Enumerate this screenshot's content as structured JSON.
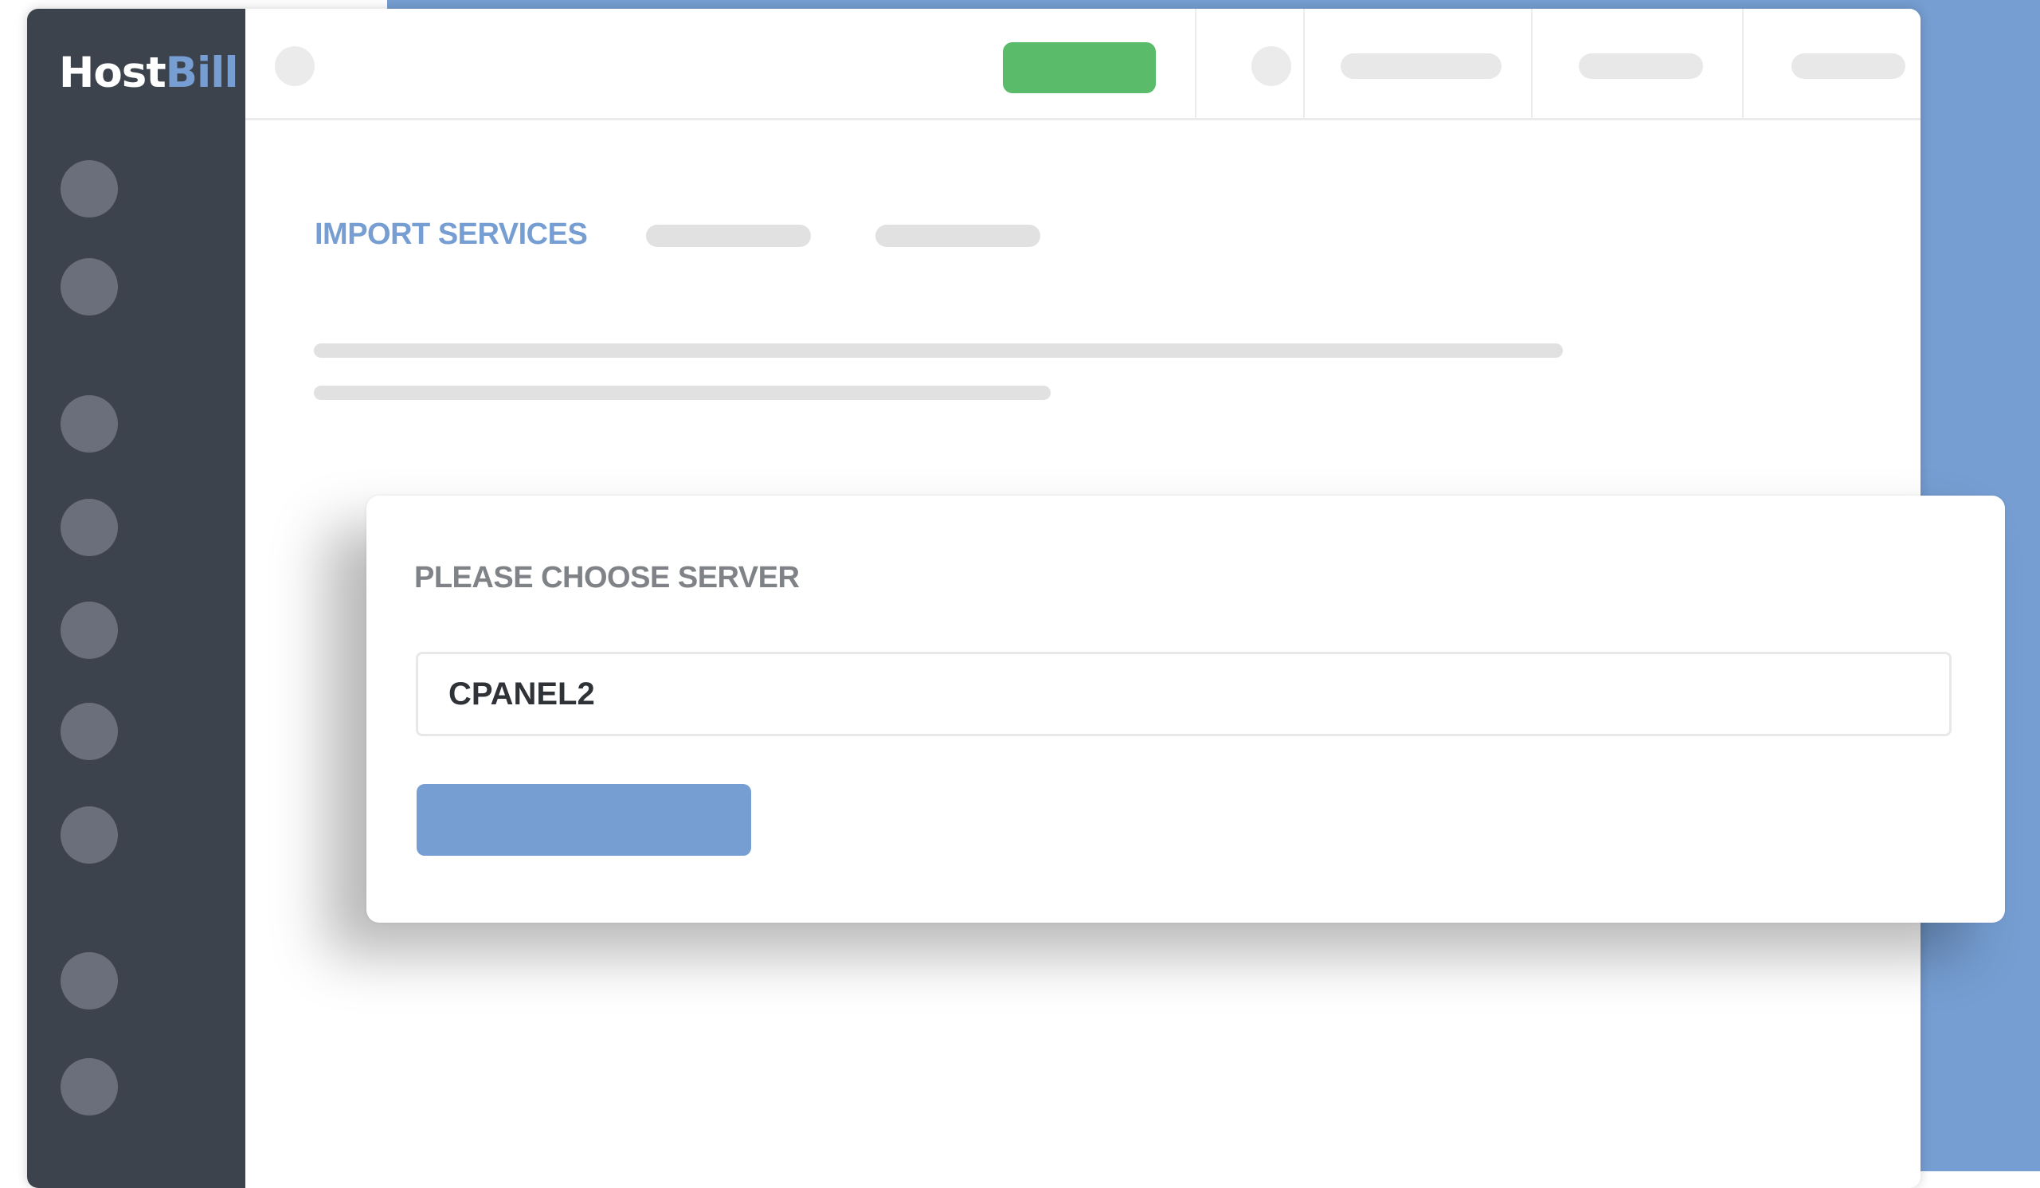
{
  "brand": {
    "name_part1": "Host",
    "name_part2": "Bill"
  },
  "colors": {
    "accent": "#769ed2",
    "sidebar": "#3d434d",
    "success": "#5abb6b",
    "placeholder": "#e1e1e1"
  },
  "tabs": {
    "active_label": "IMPORT SERVICES"
  },
  "dialog": {
    "title": "PLEASE CHOOSE SERVER",
    "server_value": "CPANEL2"
  }
}
